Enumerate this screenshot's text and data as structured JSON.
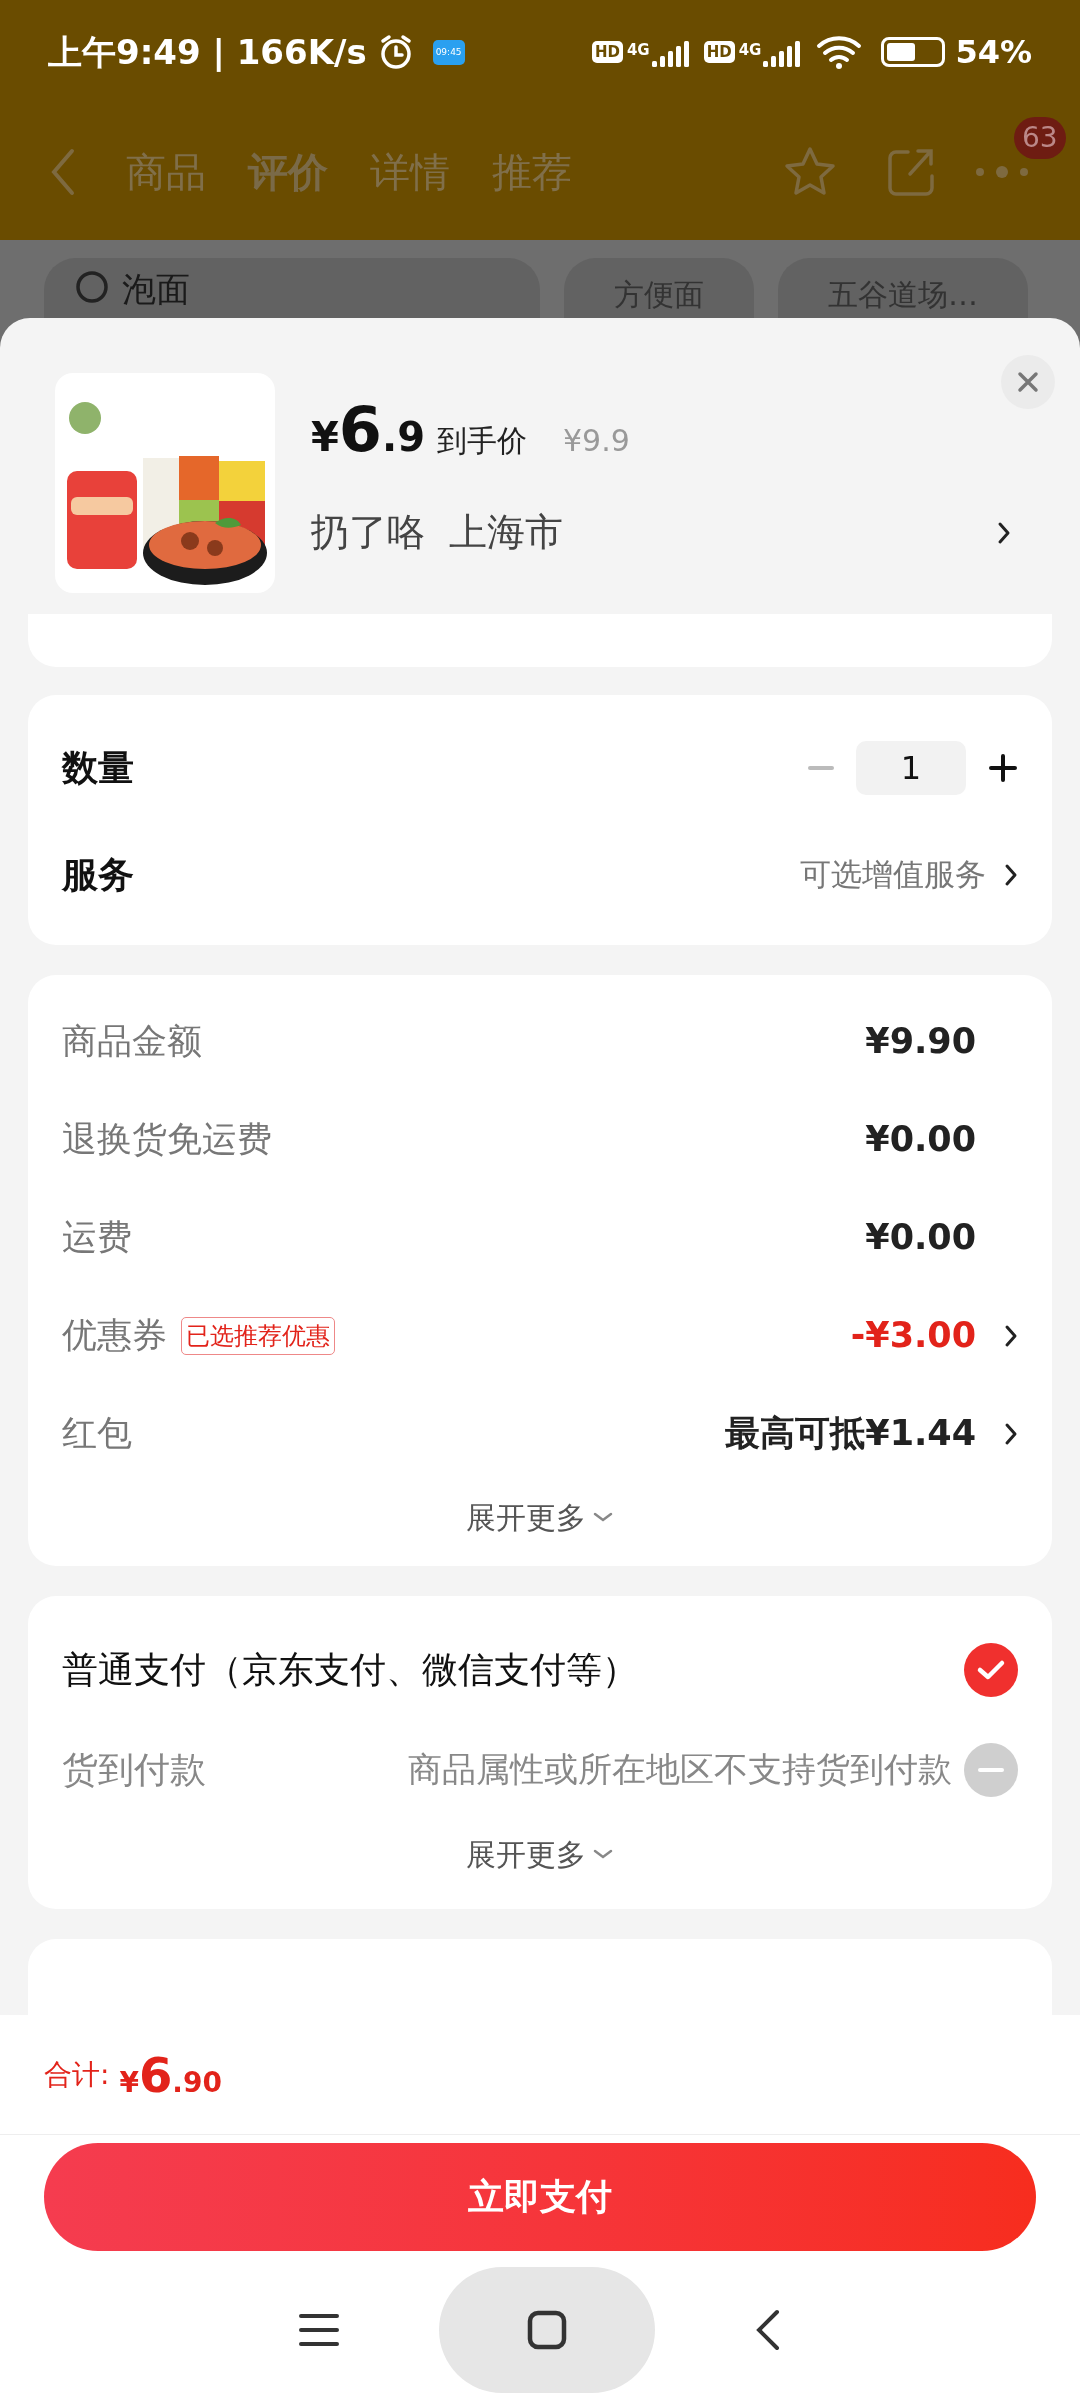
{
  "status_bar": {
    "time": "上午9:49 | 166K/s",
    "app_badge": "09:45",
    "sims": [
      {
        "hd": "HD",
        "network": "4G"
      },
      {
        "hd": "HD",
        "network": "4G"
      }
    ],
    "battery": "54%"
  },
  "header": {
    "tabs": [
      {
        "label": "商品",
        "selected": false
      },
      {
        "label": "评价",
        "selected": true
      },
      {
        "label": "详情",
        "selected": false
      },
      {
        "label": "推荐",
        "selected": false
      }
    ],
    "badge": "63"
  },
  "search": {
    "value": "泡面",
    "chips": [
      "方便面",
      "五谷道场…"
    ]
  },
  "product": {
    "currency": "¥",
    "price_int": "6",
    "price_dec": ".9",
    "price_label": "到手价",
    "original_price": "¥9.9",
    "shop": "扔了咯",
    "city": "上海市"
  },
  "quantity": {
    "label": "数量",
    "value": "1",
    "minus_disabled": true
  },
  "service": {
    "label": "服务",
    "value": "可选增值服务"
  },
  "costs": [
    {
      "label": "商品金额",
      "value": "¥9.90",
      "highlight": false,
      "link": false
    },
    {
      "label": "退换货免运费",
      "value": "¥0.00",
      "highlight": false,
      "link": false
    },
    {
      "label": "运费",
      "value": "¥0.00",
      "highlight": false,
      "link": false
    },
    {
      "label": "优惠券",
      "tag": "已选推荐优惠",
      "value": "-¥3.00",
      "highlight": true,
      "link": true
    },
    {
      "label": "红包",
      "value": "最高可抵¥1.44",
      "highlight": false,
      "link": true
    }
  ],
  "costs_expand": "展开更多",
  "payments": [
    {
      "label": "普通支付（京东支付、微信支付等）",
      "selected": true,
      "disabled": false
    },
    {
      "label": "货到付款",
      "note": "商品属性或所在地区不支持货到付款",
      "selected": false,
      "disabled": true
    }
  ],
  "payments_expand": "展开更多",
  "total": {
    "label": "合计:",
    "currency": "¥",
    "int": "6",
    "dec": ".90"
  },
  "pay_button": "立即支付"
}
